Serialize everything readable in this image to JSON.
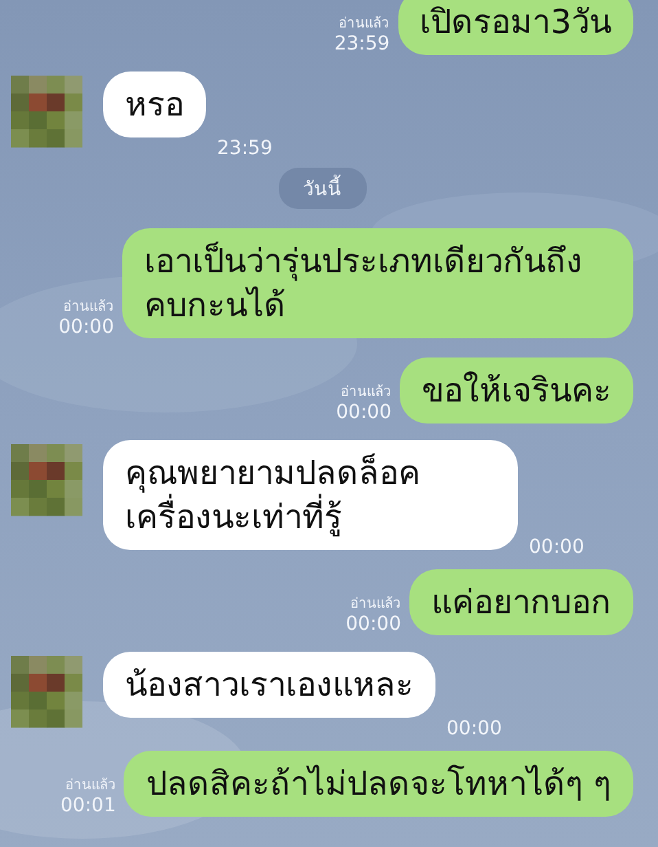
{
  "messages": [
    {
      "kind": "sent",
      "text": "เปิดรอมา3วัน",
      "read_label": "อ่านแล้ว",
      "time": "23:59"
    },
    {
      "kind": "received",
      "text": "หรอ",
      "time": "23:59"
    },
    {
      "kind": "date",
      "text": "วันนี้"
    },
    {
      "kind": "sent",
      "text": "เอาเป็นว่ารุ่นประเภทเดียวกันถึงคบกะนได้",
      "read_label": "อ่านแล้ว",
      "time": "00:00"
    },
    {
      "kind": "sent",
      "text": "ขอให้เจรินคะ",
      "read_label": "อ่านแล้ว",
      "time": "00:00"
    },
    {
      "kind": "received",
      "text": "คุณพยายามปลดล็อคเครื่องนะเท่าที่รู้",
      "time": "00:00"
    },
    {
      "kind": "sent",
      "text": "แค่อยากบอก",
      "read_label": "อ่านแล้ว",
      "time": "00:00"
    },
    {
      "kind": "received",
      "text": "น้องสาวเราเองแหละ",
      "time": "00:00"
    },
    {
      "kind": "sent",
      "text": "ปลดสิคะถ้าไม่ปลดจะโทหาได้ๆ ๆ",
      "read_label": "อ่านแล้ว",
      "time": "00:01"
    }
  ]
}
